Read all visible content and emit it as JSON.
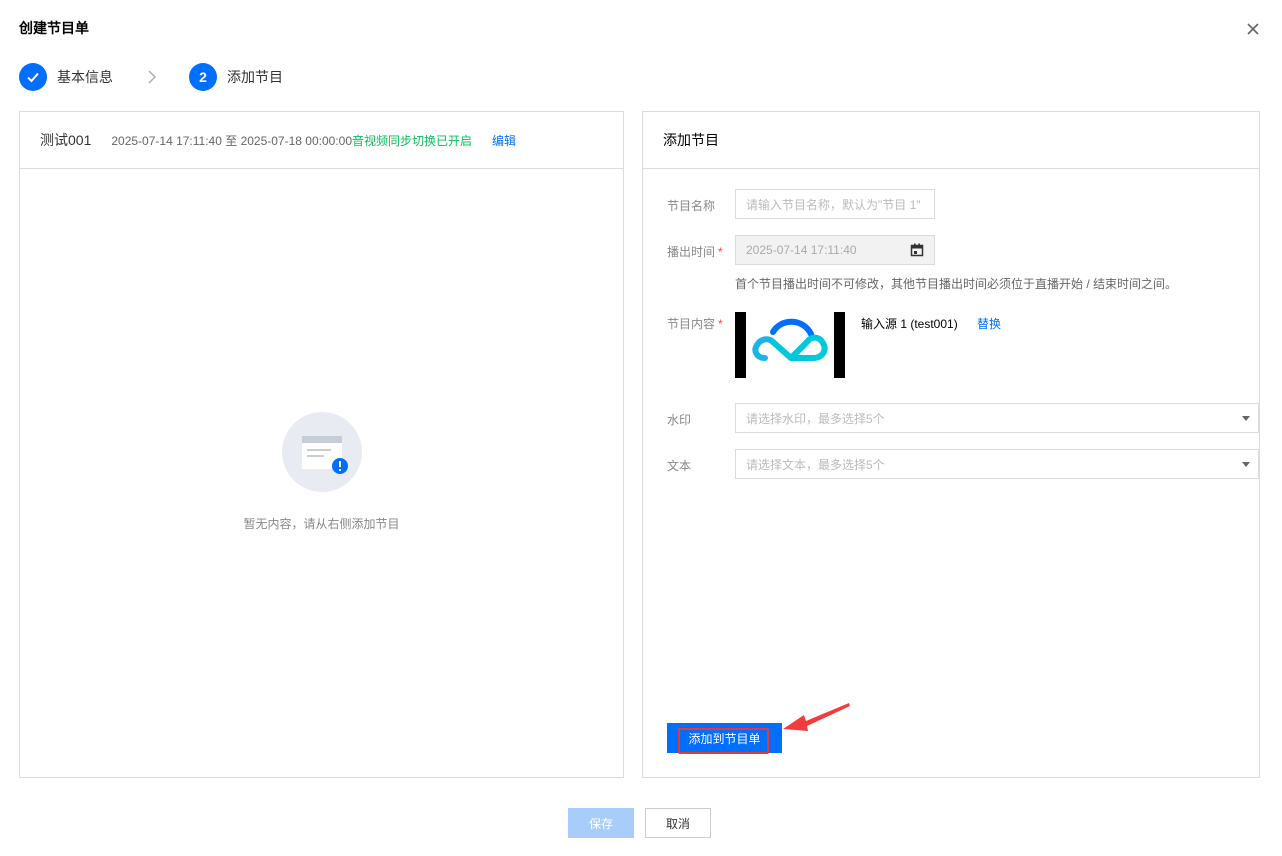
{
  "dialog": {
    "title": "创建节目单"
  },
  "steps": [
    {
      "number": "",
      "label": "基本信息",
      "status": "completed"
    },
    {
      "number": "2",
      "label": "添加节目",
      "status": "active"
    }
  ],
  "schedule": {
    "name": "测试001",
    "time_range": "2025-07-14 17:11:40 至 2025-07-18 00:00:00",
    "sync_status": "音视频同步切换已开启",
    "edit_label": "编辑",
    "empty_text": "暂无内容，请从右侧添加节目"
  },
  "add_program": {
    "title": "添加节目",
    "name_label": "节目名称",
    "name_placeholder": "请输入节目名称，默认为\"节目 1\"",
    "time_label": "播出时间",
    "time_value": "2025-07-14 17:11:40",
    "time_hint": "首个节目播出时间不可修改，其他节目播出时间必须位于直播开始 / 结束时间之间。",
    "content_label": "节目内容",
    "source_name": "输入源 1 (test001)",
    "replace_label": "替换",
    "watermark_label": "水印",
    "watermark_placeholder": "请选择水印，最多选择5个",
    "text_label": "文本",
    "text_placeholder": "请选择文本，最多选择5个",
    "add_button": "添加到节目单"
  },
  "footer": {
    "save_label": "保存",
    "cancel_label": "取消"
  },
  "colors": {
    "primary": "#006eff",
    "success": "#0abf5b",
    "required": "#e54545",
    "highlight": "#e53935"
  }
}
